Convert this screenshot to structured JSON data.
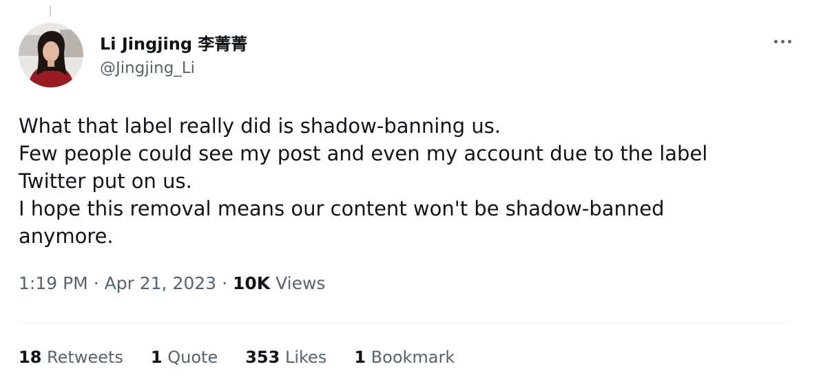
{
  "author": {
    "display_name": "Li Jingjing 李菁菁",
    "handle": "@Jingjing_Li"
  },
  "menu": {
    "more_icon": "more-horizontal-icon"
  },
  "tweet": {
    "lines": [
      "What that label really did is shadow-banning us.",
      "Few people could see my post and even my account due to the label",
      "Twitter put on us.",
      "I hope this removal means our content won't be shadow-banned",
      "anymore."
    ]
  },
  "meta": {
    "time": "1:19 PM",
    "separator": "·",
    "date": "Apr 21, 2023",
    "views_count": "10K",
    "views_label": "Views"
  },
  "stats": [
    {
      "count": "18",
      "label": "Retweets"
    },
    {
      "count": "1",
      "label": "Quote"
    },
    {
      "count": "353",
      "label": "Likes"
    },
    {
      "count": "1",
      "label": "Bookmark"
    }
  ],
  "colors": {
    "text_primary": "#0f1419",
    "text_secondary": "#536471",
    "divider": "#eff3f4"
  }
}
